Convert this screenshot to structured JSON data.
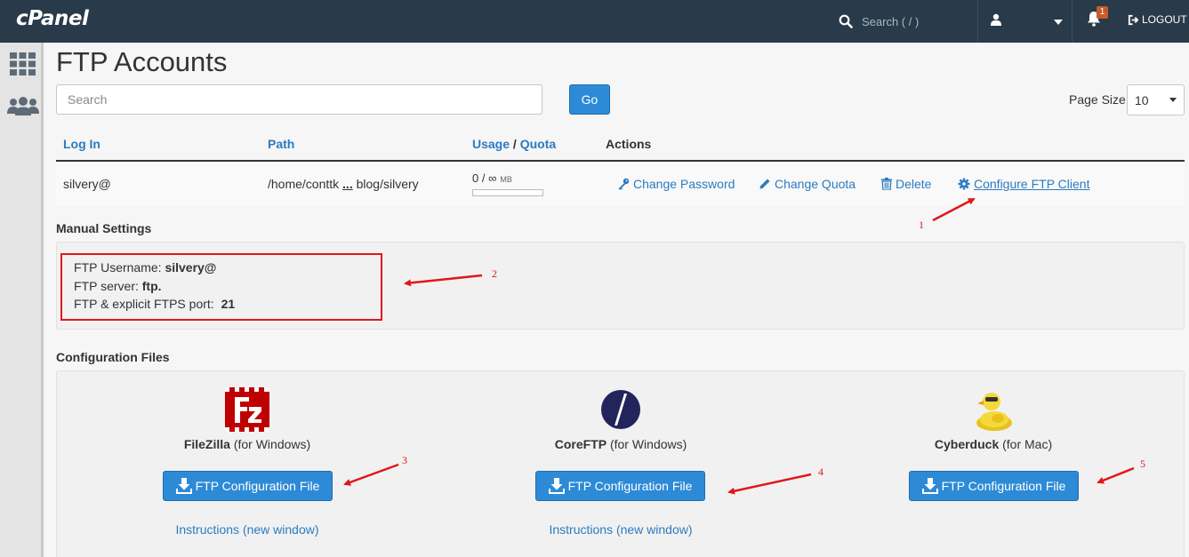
{
  "header": {
    "logo": "cPanel",
    "search_placeholder": "Search ( / )",
    "notification_count": "1",
    "logout_label": "LOGOUT"
  },
  "page": {
    "title": "FTP Accounts",
    "search_placeholder": "Search",
    "go_label": "Go",
    "page_size_label": "Page Size",
    "page_size_value": "10"
  },
  "table": {
    "headers": {
      "login": "Log In",
      "path": "Path",
      "usage": "Usage",
      "slash": "/",
      "quota": "Quota",
      "actions": "Actions"
    },
    "row": {
      "login": "silvery@",
      "path_start": "/home/conttk",
      "path_ellipsis": "...",
      "path_end": "blog/silvery",
      "usage": "0 / ∞",
      "usage_unit": "MB",
      "usage_fraction": 0
    },
    "actions": {
      "change_password": "Change Password",
      "change_quota": "Change Quota",
      "delete": "Delete",
      "configure": "Configure FTP Client"
    }
  },
  "manual": {
    "title": "Manual Settings",
    "username_label": "FTP Username:",
    "username_value": "silvery@",
    "server_label": "FTP server:",
    "server_value": "ftp.",
    "port_label": "FTP & explicit FTPS port:",
    "port_value": "21"
  },
  "config": {
    "title": "Configuration Files",
    "clients": [
      {
        "name": "FileZilla",
        "platform": "(for Windows)",
        "button": "FTP Configuration File",
        "instructions": "Instructions (new window)"
      },
      {
        "name": "CoreFTP",
        "platform": "(for Windows)",
        "button": "FTP Configuration File",
        "instructions": "Instructions (new window)"
      },
      {
        "name": "Cyberduck",
        "platform": "(for Mac)",
        "button": "FTP Configuration File",
        "instructions": "Instructions (new window)"
      }
    ]
  },
  "annotations": [
    "1",
    "2",
    "3",
    "4",
    "5"
  ],
  "colors": {
    "topbar": "#293a4a",
    "accent": "#2d8ad6",
    "link": "#2b7bc0",
    "annotation": "#e0171b"
  }
}
